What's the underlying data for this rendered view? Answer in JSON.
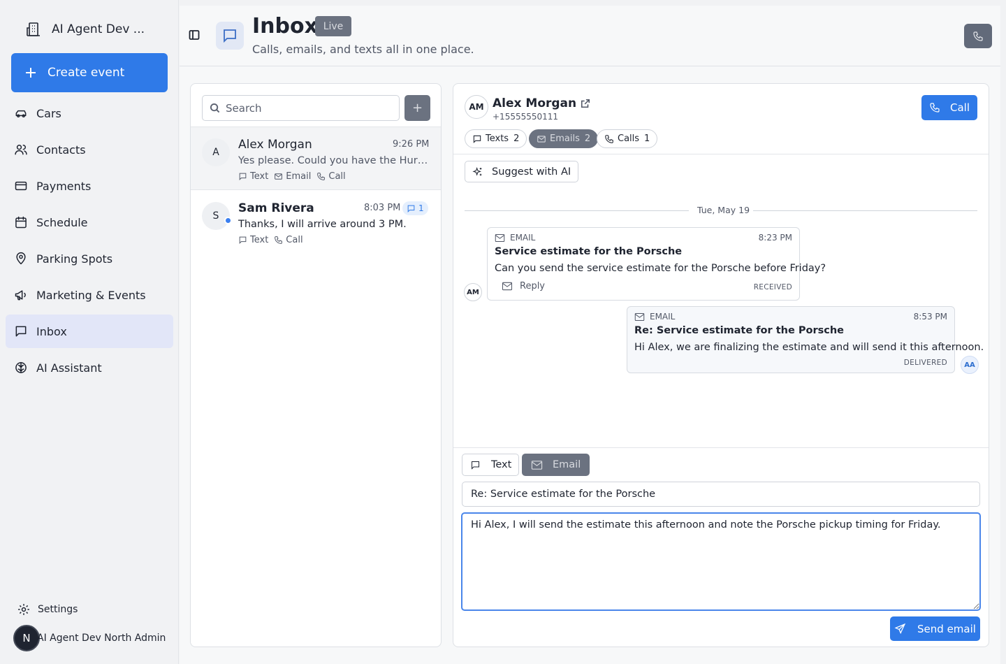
{
  "sidebar": {
    "org_name": "AI Agent Dev ...",
    "create_label": "Create event",
    "items": [
      {
        "label": "Cars",
        "icon": "car-icon"
      },
      {
        "label": "Contacts",
        "icon": "users-icon"
      },
      {
        "label": "Payments",
        "icon": "credit-card-icon"
      },
      {
        "label": "Schedule",
        "icon": "calendar-icon"
      },
      {
        "label": "Parking Spots",
        "icon": "map-pin-icon"
      },
      {
        "label": "Marketing & Events",
        "icon": "megaphone-icon"
      },
      {
        "label": "Inbox",
        "icon": "message-square-icon",
        "active": true
      },
      {
        "label": "AI Assistant",
        "icon": "brain-icon"
      }
    ],
    "settings_label": "Settings",
    "user_initial": "N",
    "user_name": "AI Agent Dev North Admin"
  },
  "header": {
    "title": "Inbox",
    "badge": "Live",
    "subtitle": "Calls, emails, and texts all in one place."
  },
  "conversations": {
    "search_placeholder": "Search",
    "add_label": "+",
    "items": [
      {
        "initial": "A",
        "name": "Alex Morgan",
        "time": "9:26 PM",
        "preview": "Yes please. Could you have the Huracan ready by Friday?",
        "channels": [
          "Text",
          "Email",
          "Call"
        ],
        "selected": true
      },
      {
        "initial": "S",
        "name": "Sam Rivera",
        "time": "8:03 PM",
        "unread_count": "1",
        "preview": "Thanks, I will arrive around 3 PM.",
        "channels": [
          "Text",
          "Call"
        ],
        "unread": true
      }
    ]
  },
  "thread": {
    "contact": {
      "initials": "AM",
      "name": "Alex Morgan",
      "phone": "+15555550111"
    },
    "call_label": "Call",
    "filters": [
      {
        "label": "Texts",
        "count": "2"
      },
      {
        "label": "Emails",
        "count": "2",
        "active": true
      },
      {
        "label": "Calls",
        "count": "1"
      }
    ],
    "suggest_label": "Suggest with AI",
    "date_label": "Tue, May 19",
    "messages": [
      {
        "type": "EMAIL",
        "time": "8:23 PM",
        "subject": "Service estimate for the Porsche",
        "body": "Can you send the service estimate for the Porsche before Friday?",
        "status": "RECEIVED",
        "reply_label": "Reply",
        "avatar": "AM"
      },
      {
        "type": "EMAIL",
        "time": "8:53 PM",
        "subject": "Re: Service estimate for the Porsche",
        "body": "Hi Alex, we are finalizing the estimate and will send it this afternoon.",
        "status": "DELIVERED",
        "avatar": "AA"
      }
    ],
    "composer": {
      "modes": [
        {
          "label": "Text"
        },
        {
          "label": "Email",
          "active": true
        }
      ],
      "subject_value": "Re: Service estimate for the Porsche",
      "body_value": "Hi Alex, I will send the estimate this afternoon and note the Porsche pickup timing for Friday.",
      "send_label": "Send email"
    }
  },
  "colors": {
    "accent": "#2f7ae8",
    "active_nav": "#e2e6f8",
    "muted_button": "#6b7280",
    "unread_dot": "#3b7ff0"
  }
}
